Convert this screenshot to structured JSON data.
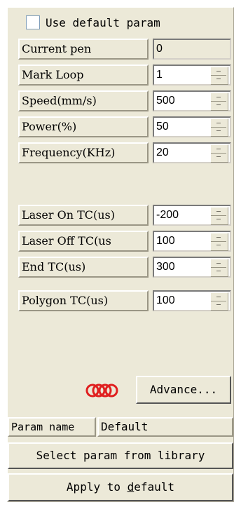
{
  "use_default": {
    "label": "Use default param",
    "checked": false
  },
  "fields": [
    {
      "label": "Current pen",
      "value": "0",
      "spinner": false
    },
    {
      "label": "Mark Loop",
      "value": "1",
      "spinner": true
    },
    {
      "label": "Speed(mm/s)",
      "value": "500",
      "spinner": true
    },
    {
      "label": "Power(%)",
      "value": "50",
      "spinner": true
    },
    {
      "label": "Frequency(KHz)",
      "value": "20",
      "spinner": true
    },
    {
      "label": "Laser On TC(us)",
      "value": "-200",
      "spinner": true
    },
    {
      "label": "Laser Off TC(us",
      "value": "100",
      "spinner": true
    },
    {
      "label": "End TC(us)",
      "value": "300",
      "spinner": true
    },
    {
      "label": "Polygon TC(us)",
      "value": "100",
      "spinner": true
    }
  ],
  "advance_button": {
    "label": "Advance...",
    "icon": "red-rings-icon",
    "icon_color": "#e02020"
  },
  "param_name": {
    "label": "Param name",
    "value": "Default"
  },
  "select_library_button": {
    "label": "Select param from library"
  },
  "apply_button": {
    "label_before": "Apply to ",
    "label_mnemonic": "d",
    "label_after": "efault"
  }
}
